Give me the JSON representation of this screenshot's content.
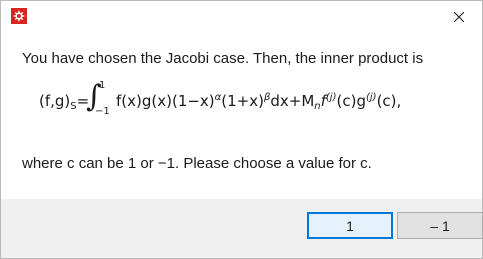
{
  "dialog": {
    "close_glyph": "close-icon",
    "icon": "app-icon"
  },
  "message": {
    "line1": "You have chosen the Jacobi case. Then, the inner product is",
    "formula": {
      "lhs": "(f,g)",
      "lhs_sub": "S",
      "eq": "=",
      "integral": "∫",
      "upper": "1",
      "lower": "−1",
      "integrand_a": "f(x)g(x)(1−x)",
      "alpha": "α",
      "integrand_b": "(1+x)",
      "beta": "β",
      "integrand_c": "dx+M",
      "n": "n",
      "integrand_d": "f",
      "j1": "(j)",
      "integrand_e": "(c)g",
      "j2": "(j)",
      "integrand_f": "(c),"
    },
    "line3": "where c can be 1 or −1. Please choose a value for c."
  },
  "buttons": {
    "one": "1",
    "neg_one": "– 1"
  },
  "colors": {
    "accent": "#0078d7",
    "footer_bg": "#f0f0f0",
    "icon_red": "#d7261e"
  }
}
